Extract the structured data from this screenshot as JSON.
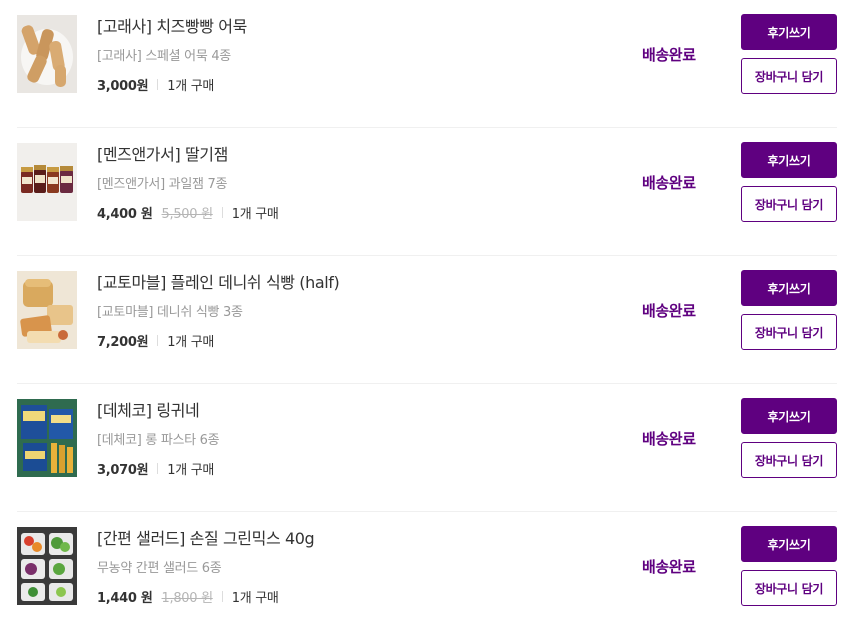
{
  "orders": [
    {
      "title": "[고래사] 치즈빵빵 어묵",
      "subtitle": "[고래사] 스페셜 어묵 4종",
      "price": "3,000원",
      "original_price": null,
      "quantity": "1개 구매",
      "status": "배송완료",
      "review_label": "후기쓰기",
      "cart_label": "장바구니 담기",
      "thumbnail": "fishcake-icon"
    },
    {
      "title": "[멘즈앤가서] 딸기잼",
      "subtitle": "[멘즈앤가서] 과일잼 7종",
      "price": "4,400 원",
      "original_price": "5,500 원",
      "quantity": "1개 구매",
      "status": "배송완료",
      "review_label": "후기쓰기",
      "cart_label": "장바구니 담기",
      "thumbnail": "jam-jars-icon"
    },
    {
      "title": "[교토마블] 플레인 데니쉬 식빵 (half)",
      "subtitle": "[교토마블] 데니쉬 식빵 3종",
      "price": "7,200원",
      "original_price": null,
      "quantity": "1개 구매",
      "status": "배송완료",
      "review_label": "후기쓰기",
      "cart_label": "장바구니 담기",
      "thumbnail": "bread-icon"
    },
    {
      "title": "[데체코] 링귀네",
      "subtitle": "[데체코] 롱 파스타 6종",
      "price": "3,070원",
      "original_price": null,
      "quantity": "1개 구매",
      "status": "배송완료",
      "review_label": "후기쓰기",
      "cart_label": "장바구니 담기",
      "thumbnail": "pasta-box-icon"
    },
    {
      "title": "[간편 샐러드] 손질 그린믹스 40g",
      "subtitle": "무농약 간편 샐러드 6종",
      "price": "1,440 원",
      "original_price": "1,800 원",
      "quantity": "1개 구매",
      "status": "배송완료",
      "review_label": "후기쓰기",
      "cart_label": "장바구니 담기",
      "thumbnail": "salad-icon"
    }
  ],
  "colors": {
    "accent": "#5f0080",
    "text": "#333333",
    "muted": "#999999",
    "divider": "#f0f0f0"
  }
}
